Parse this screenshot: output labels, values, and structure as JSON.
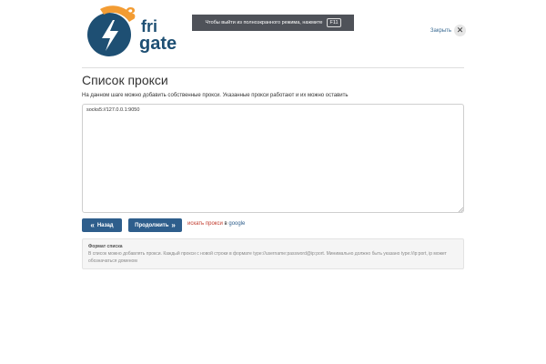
{
  "logo": {
    "digit": "3",
    "line1": "fri",
    "line2": "gate",
    "colors": {
      "dark": "#1e4f73",
      "orange": "#f39c33"
    }
  },
  "fullscreen_banner": {
    "text": "Чтобы выйти из полноэкранного режима, нажмите",
    "key": "F11"
  },
  "close": {
    "label": "Закрыть",
    "icon": "close-icon"
  },
  "page": {
    "title": "Список прокси",
    "description": "На данном шаге можно добавить собственные прокси. Указанные прокси работают и их можно оставить"
  },
  "proxy_list": {
    "value": "socks5://127.0.0.1:9050"
  },
  "buttons": {
    "back_label": "Назад",
    "next_label": "Продолжить",
    "back_icon": "double-chevron-left-icon",
    "next_icon": "double-chevron-right-icon",
    "color": "#2e5e8c"
  },
  "search": {
    "link_text": "искать прокси",
    "mid_text": " в ",
    "google_text": "google"
  },
  "info": {
    "title": "Формат списка",
    "text": "В список можно добавлять прокси. Каждый прокси с новой строки в формате type://username:password@ip:port. Минимально должно быть указано type://ip:port, ip может обозначаться доменом"
  }
}
